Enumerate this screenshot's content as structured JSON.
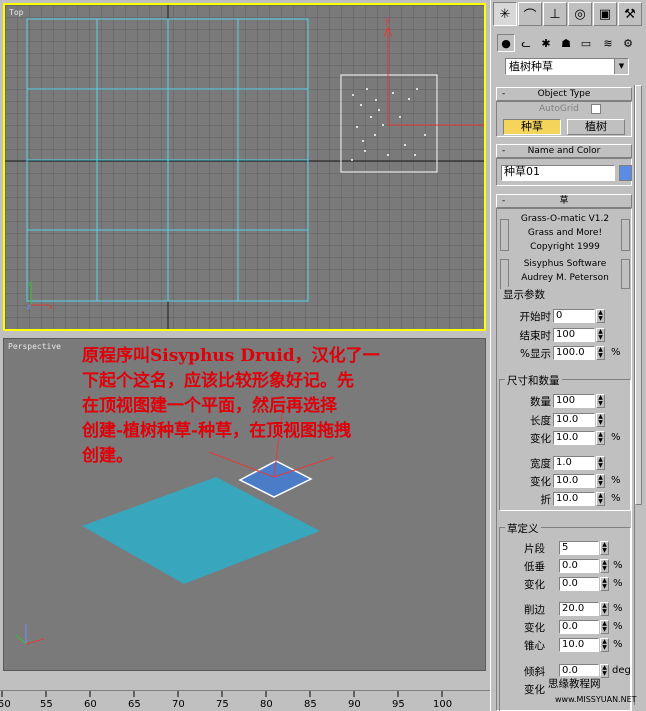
{
  "viewports": {
    "top_label": "Top",
    "perspective_label": "Perspective",
    "annotation_lines": [
      "原程序叫Sisyphus Druid，汉化了一",
      "下起个这名，应该比较形象好记。先",
      "在顶视图建一个平面，然后再选择",
      "创建-植树种草-种草，在顶视图拖拽",
      "创建。"
    ]
  },
  "ruler": {
    "ticks": [
      "50",
      "55",
      "60",
      "65",
      "70",
      "75",
      "80",
      "85",
      "90",
      "95",
      "100"
    ]
  },
  "command_panel": {
    "tabs": [
      "create-icon",
      "modify-icon",
      "hierarchy-icon",
      "motion-icon",
      "display-icon",
      "utilities-icon"
    ],
    "subtabs": [
      "geometry-icon",
      "shapes-icon",
      "lights-icon",
      "cameras-icon",
      "helpers-icon",
      "spacewarps-icon",
      "systems-icon"
    ],
    "category_select": "植树种草",
    "object_type": {
      "title": "Object Type",
      "autogrid_label": "AutoGrid",
      "buttons": [
        "种草",
        "植树"
      ]
    },
    "name_color": {
      "title": "Name and Color",
      "name_value": "种草01",
      "color": "#5a8ce6"
    },
    "grass": {
      "title": "草",
      "credits": [
        "Grass-O-matic V1.2",
        "Grass and More!",
        "Copyright 1999",
        "Sisyphus Software",
        "Audrey M. Peterson"
      ],
      "display_group": "显示参数",
      "start_time_label": "开始时",
      "start_time": "0",
      "end_time_label": "结束时",
      "end_time": "100",
      "display_pct_label": "%显示",
      "display_pct": "100.0",
      "size_group": "尺寸和数量",
      "count_label": "数量",
      "count": "100",
      "length_label": "长度",
      "length": "10.0",
      "length_var_label": "变化",
      "length_var": "10.0",
      "width_label": "宽度",
      "width": "1.0",
      "width_var_label": "变化",
      "width_var": "10.0",
      "fold_label": "折",
      "fold": "10.0",
      "blade_group": "草定义",
      "segments_label": "片段",
      "segments": "5",
      "low_label": "低垂",
      "low": "0.0",
      "low_var_label": "变化",
      "low_var": "0.0",
      "edge_label": "削边",
      "edge": "20.0",
      "edge_var_label": "变化",
      "edge_var": "0.0",
      "center_label": "锥心",
      "center": "10.0",
      "tilt_label": "倾斜",
      "tilt": "0.0",
      "tilt_var_label": "变化",
      "pct": "%",
      "deg": "deg"
    }
  },
  "watermark": {
    "line1": "思缘教程网",
    "line2": "www.MISSYUAN.NET"
  }
}
